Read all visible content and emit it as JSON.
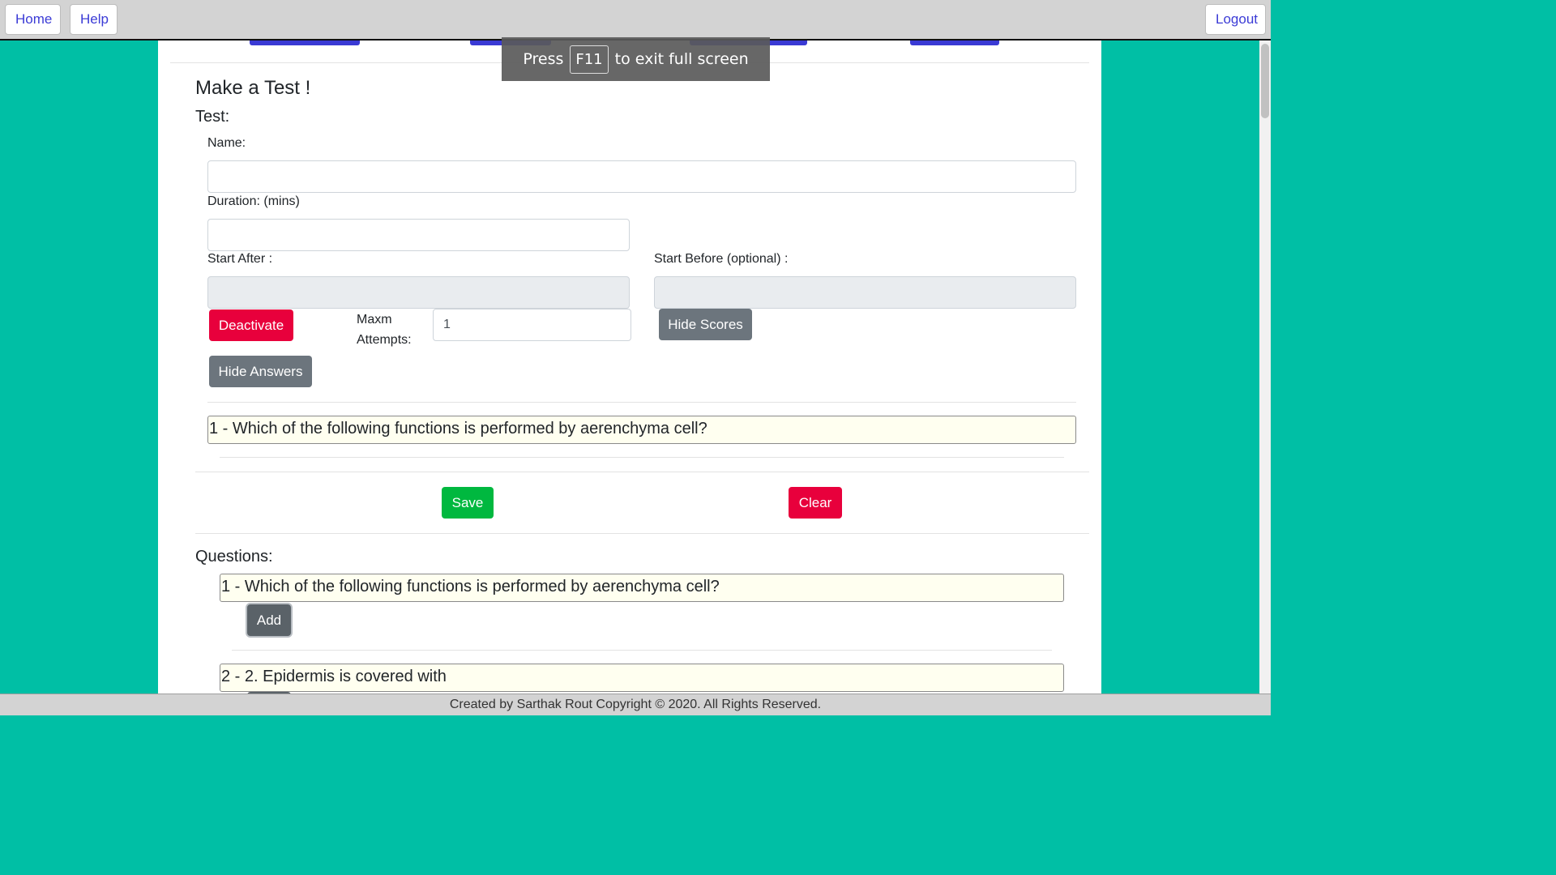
{
  "nav": {
    "home": "Home",
    "help": "Help",
    "logout": "Logout"
  },
  "fullscreen": {
    "press": "Press",
    "key": "F11",
    "rest": "to exit full screen"
  },
  "page": {
    "title": "Make a Test !",
    "test_heading": "Test:",
    "name_label": "Name:",
    "name_value": "",
    "duration_label": "Duration: (mins)",
    "duration_value": "",
    "start_after_label": "Start After :",
    "start_before_label": "Start Before (optional) :",
    "deactivate": "Deactivate",
    "maxm_label_1": "Maxm",
    "maxm_label_2": "Attempts:",
    "maxm_value": "1",
    "hide_scores": "Hide Scores",
    "hide_answers": "Hide Answers",
    "selected_question": "1 - Which of the following functions is performed by aerenchyma cell?",
    "save": "Save",
    "clear": "Clear",
    "questions_heading": "Questions:",
    "questions": [
      {
        "text": "1 - Which of the following functions is performed by aerenchyma cell?",
        "add": "Add"
      },
      {
        "text": "2 - 2. Epidermis is covered with"
      }
    ]
  },
  "footer": "Created by Sarthak Rout Copyright © 2020. All Rights Reserved.",
  "colors": {
    "background": "#00bfa5",
    "danger": "#e8003c",
    "success": "#00b83f",
    "secondary": "#6c757d",
    "link": "#3b3bd6"
  }
}
